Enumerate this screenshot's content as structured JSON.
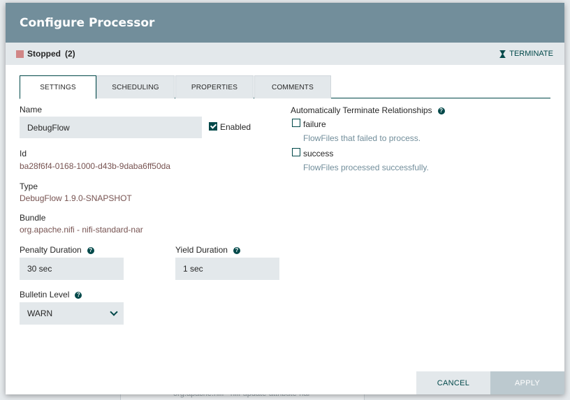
{
  "dialog": {
    "title": "Configure Processor"
  },
  "status": {
    "state": "Stopped",
    "count": "(2)",
    "terminate_label": "TERMINATE"
  },
  "tabs": [
    {
      "label": "SETTINGS"
    },
    {
      "label": "SCHEDULING"
    },
    {
      "label": "PROPERTIES"
    },
    {
      "label": "COMMENTS"
    }
  ],
  "settings": {
    "name_label": "Name",
    "name_value": "DebugFlow",
    "enabled_label": "Enabled",
    "id_label": "Id",
    "id_value": "ba28f6f4-0168-1000-d43b-9daba6ff50da",
    "type_label": "Type",
    "type_value": "DebugFlow 1.9.0-SNAPSHOT",
    "bundle_label": "Bundle",
    "bundle_value": "org.apache.nifi - nifi-standard-nar",
    "penalty_label": "Penalty Duration",
    "penalty_value": "30 sec",
    "yield_label": "Yield Duration",
    "yield_value": "1 sec",
    "bulletin_label": "Bulletin Level",
    "bulletin_value": "WARN"
  },
  "relationships": {
    "title": "Automatically Terminate Relationships",
    "items": [
      {
        "name": "failure",
        "description": "FlowFiles that failed to process."
      },
      {
        "name": "success",
        "description": "FlowFiles processed successfully."
      }
    ]
  },
  "footer": {
    "cancel_label": "CANCEL",
    "apply_label": "APPLY"
  },
  "background": {
    "partial_text": "org.apache.nifi - nifi-update-attribute-nar"
  }
}
